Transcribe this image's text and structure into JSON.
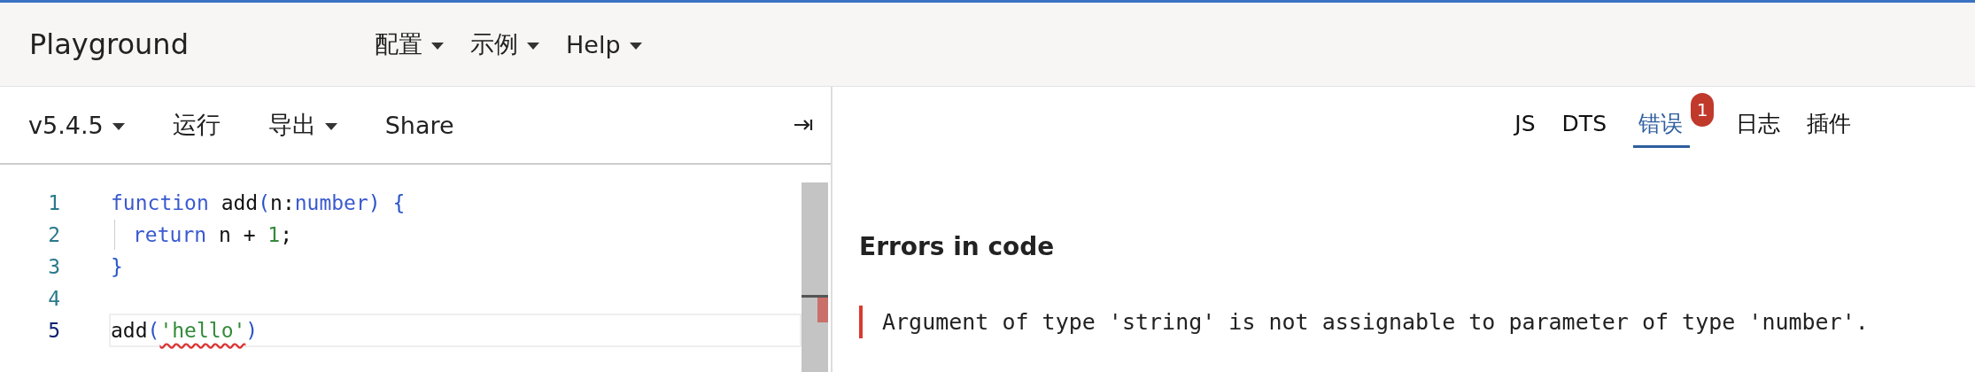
{
  "header": {
    "title": "Playground",
    "menus": [
      {
        "label": "配置"
      },
      {
        "label": "示例"
      },
      {
        "label": "Help"
      }
    ]
  },
  "toolbar": {
    "items": [
      {
        "label": "v5.4.5",
        "dropdown": true
      },
      {
        "label": "运行",
        "dropdown": false
      },
      {
        "label": "导出",
        "dropdown": true
      },
      {
        "label": "Share",
        "dropdown": false
      }
    ]
  },
  "editor": {
    "lines": [
      {
        "number": "1",
        "current": false,
        "tokens": [
          {
            "text": "function",
            "kind": "keyword"
          },
          {
            "text": " add",
            "kind": "plain"
          },
          {
            "text": "(",
            "kind": "punct"
          },
          {
            "text": "n:",
            "kind": "plain"
          },
          {
            "text": "number",
            "kind": "keyword"
          },
          {
            "text": ") {",
            "kind": "punct"
          }
        ]
      },
      {
        "number": "2",
        "current": false,
        "indent": true,
        "tokens": [
          {
            "text": "return",
            "kind": "keyword"
          },
          {
            "text": " n + ",
            "kind": "plain"
          },
          {
            "text": "1",
            "kind": "number"
          },
          {
            "text": ";",
            "kind": "plain"
          }
        ]
      },
      {
        "number": "3",
        "current": false,
        "tokens": [
          {
            "text": "}",
            "kind": "punct"
          }
        ]
      },
      {
        "number": "4",
        "current": false
      },
      {
        "number": "5",
        "current": true,
        "tokens": [
          {
            "text": "add",
            "kind": "plain"
          },
          {
            "text": "(",
            "kind": "punct"
          },
          {
            "text": "'hello'",
            "kind": "string",
            "error": true
          },
          {
            "text": ")",
            "kind": "punct"
          }
        ]
      }
    ]
  },
  "output_tabs": [
    {
      "label": "JS",
      "selected": false
    },
    {
      "label": "DTS",
      "selected": false
    },
    {
      "label": "错误",
      "selected": true,
      "badge": "1"
    },
    {
      "label": "日志",
      "selected": false
    },
    {
      "label": "插件",
      "selected": false
    }
  ],
  "errors": {
    "heading": "Errors in code",
    "messages": [
      "Argument of type 'string' is not assignable to parameter of type 'number'."
    ]
  }
}
